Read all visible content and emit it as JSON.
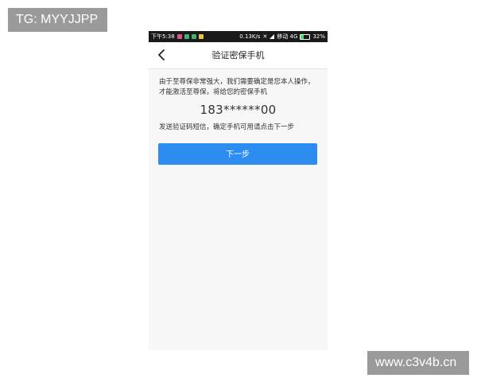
{
  "watermarks": {
    "top_left": "TG: MYYJJPP",
    "bottom_right": "www.c3v4b.cn"
  },
  "status_bar": {
    "time": "下午5:38",
    "network_speed": "0.13K/s",
    "carrier": "移动 4G",
    "battery": "32%",
    "battery_fill_fraction": 0.32,
    "app_icon_colors": [
      "#e84d8a",
      "#3cb371",
      "#3cb371",
      "#f0c040"
    ]
  },
  "nav": {
    "back_icon": "chevron-left-icon",
    "title": "验证密保手机"
  },
  "content": {
    "description": "由于至尊保非常强大，我们需要确定是您本人操作，才能激活至尊保，将给您的密保手机",
    "phone_number": "183******00",
    "send_note": "发送验证码短信，确定手机可用请点击下一步",
    "next_button": "下一步"
  },
  "colors": {
    "primary_button": "#2d8cf0",
    "page_background": "#f7f7f7",
    "status_bar": "#1a1a1a",
    "watermark_bg": "#9a9a9a"
  }
}
